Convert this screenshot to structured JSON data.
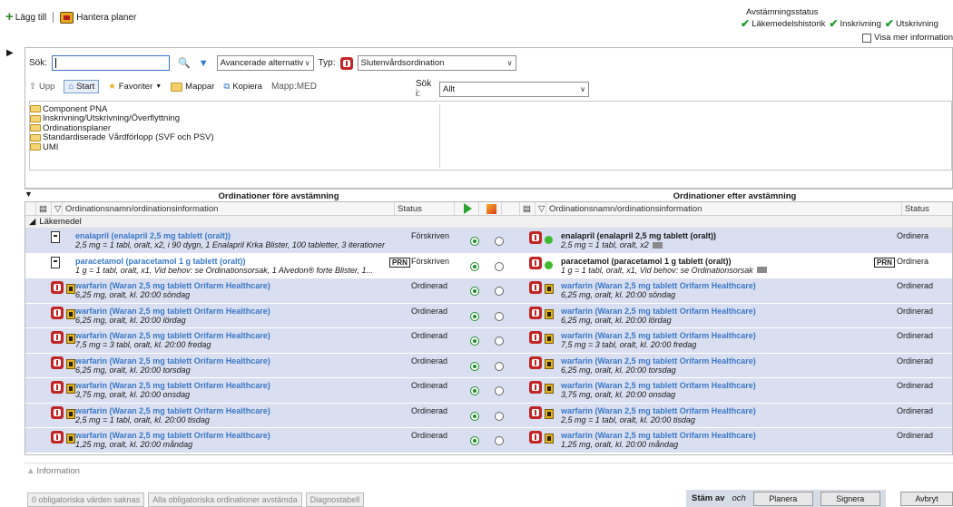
{
  "toolbar": {
    "add_label": "Lägg till",
    "manage_plans_label": "Hantera planer"
  },
  "status": {
    "title": "Avstämningsstatus",
    "items": [
      "Läkemedelshistorik",
      "Inskrivning",
      "Utskrivning"
    ],
    "show_more_label": "Visa mer information"
  },
  "search": {
    "label": "Sök:",
    "value": "",
    "advanced_label": "Avancerade alternativ",
    "type_label": "Typ:",
    "type_value": "Slutenvårdsordination",
    "search_in_label": "Sök i:",
    "search_in_value": "Allt"
  },
  "nav": {
    "up": "Upp",
    "start": "Start",
    "favorites": "Favoriter",
    "folders": "Mappar",
    "copy": "Kopiera",
    "folder_path": "Mapp:MED"
  },
  "tree": [
    "Component PNA",
    "Inskrivning/Utskrivning/Överflyttning",
    "Ordinationsplaner",
    "Standardiserade Vårdförlopp (SVF och PSV)",
    "UMI"
  ],
  "grid": {
    "left_title": "Ordinationer före avstämning",
    "right_title": "Ordinationer efter avstämning",
    "col_name": "Ordinationsnamn/ordinationsinformation",
    "col_status": "Status",
    "group": "Läkemedel",
    "rows": [
      {
        "left_name": "enalapril (enalapril 2,5 mg tablett (oralt))",
        "left_detail": "2,5 mg = 1 tabl, oralt, x2, i 90 dygn, 1 Enalapril Krka Blister, 100 tabletter, 3 iterationer",
        "left_status": "Förskriven",
        "right_name": "enalapril (enalapril 2,5 mg tablett (oralt))",
        "right_detail": "2,5 mg = 1 tabl, oralt, x2",
        "right_status": "Ordinera"
      },
      {
        "left_name": "paracetamol (paracetamol 1 g tablett (oralt))",
        "left_detail": "1 g = 1 tabl, oralt, x1, Vid behov: se Ordinationsorsak, 1 Alvedon® forte Blister, 1...",
        "left_status": "Förskriven",
        "prn": "PRN",
        "right_name": "paracetamol (paracetamol 1 g tablett (oralt))",
        "right_detail": "1 g = 1 tabl, oralt, x1, Vid behov: se Ordinationsorsak",
        "right_status": "Ordinera"
      },
      {
        "left_name": "warfarin (Waran 2,5 mg tablett Orifarm Healthcare)",
        "left_detail": "6,25 mg, oralt, kl. 20:00 söndag",
        "left_status": "Ordinerad",
        "right_name": "warfarin (Waran 2,5 mg tablett Orifarm Healthcare)",
        "right_detail": "6,25 mg, oralt, kl. 20:00 söndag",
        "right_status": "Ordinerad"
      },
      {
        "left_name": "warfarin (Waran 2,5 mg tablett Orifarm Healthcare)",
        "left_detail": "6,25 mg, oralt, kl. 20:00 lördag",
        "left_status": "Ordinerad",
        "right_name": "warfarin (Waran 2,5 mg tablett Orifarm Healthcare)",
        "right_detail": "6,25 mg, oralt, kl. 20:00 lördag",
        "right_status": "Ordinerad"
      },
      {
        "left_name": "warfarin (Waran 2,5 mg tablett Orifarm Healthcare)",
        "left_detail": "7,5 mg = 3 tabl, oralt, kl. 20:00 fredag",
        "left_status": "Ordinerad",
        "right_name": "warfarin (Waran 2,5 mg tablett Orifarm Healthcare)",
        "right_detail": "7,5 mg = 3 tabl, oralt, kl. 20:00 fredag",
        "right_status": "Ordinerad"
      },
      {
        "left_name": "warfarin (Waran 2,5 mg tablett Orifarm Healthcare)",
        "left_detail": "6,25 mg, oralt, kl. 20:00 torsdag",
        "left_status": "Ordinerad",
        "right_name": "warfarin (Waran 2,5 mg tablett Orifarm Healthcare)",
        "right_detail": "6,25 mg, oralt, kl. 20:00 torsdag",
        "right_status": "Ordinerad"
      },
      {
        "left_name": "warfarin (Waran 2,5 mg tablett Orifarm Healthcare)",
        "left_detail": "3,75 mg, oralt, kl. 20:00 onsdag",
        "left_status": "Ordinerad",
        "right_name": "warfarin (Waran 2,5 mg tablett Orifarm Healthcare)",
        "right_detail": "3,75 mg, oralt, kl. 20:00 onsdag",
        "right_status": "Ordinerad"
      },
      {
        "left_name": "warfarin (Waran 2,5 mg tablett Orifarm Healthcare)",
        "left_detail": "2,5 mg = 1 tabl, oralt, kl. 20:00 tisdag",
        "left_status": "Ordinerad",
        "right_name": "warfarin (Waran 2,5 mg tablett Orifarm Healthcare)",
        "right_detail": "2,5 mg = 1 tabl, oralt, kl. 20:00 tisdag",
        "right_status": "Ordinerad"
      },
      {
        "left_name": "warfarin (Waran 2,5 mg tablett Orifarm Healthcare)",
        "left_detail": "1,25 mg, oralt, kl. 20:00 måndag",
        "left_status": "Ordinerad",
        "right_name": "warfarin (Waran 2,5 mg tablett Orifarm Healthcare)",
        "right_detail": "1,25 mg, oralt, kl. 20:00 måndag",
        "right_status": "Ordinerad"
      }
    ]
  },
  "info": {
    "label": "Information"
  },
  "footer": {
    "missing_label": "0 obligatoriska värden saknas",
    "all_reconciled_label": "Alla obligatoriska ordinationer avstämda",
    "diagnos_label": "Diagnostabell",
    "stam_av": "Stäm av",
    "och": "och",
    "planera": "Planera",
    "signera": "Signera",
    "avbryt": "Avbryt"
  }
}
